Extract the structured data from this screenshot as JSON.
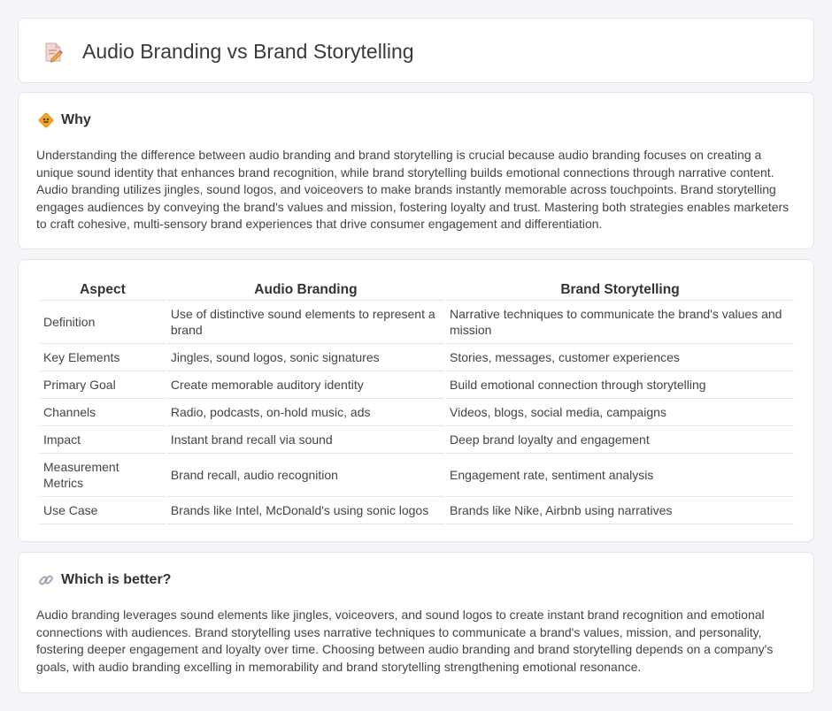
{
  "page": {
    "title": "Audio Branding vs Brand Storytelling",
    "title_icon": "document-pencil-icon"
  },
  "why": {
    "heading": "Why",
    "icon": "diamond-sign-icon",
    "text": "Understanding the difference between audio branding and brand storytelling is crucial because audio branding focuses on creating a unique sound identity that enhances brand recognition, while brand storytelling builds emotional connections through narrative content. Audio branding utilizes jingles, sound logos, and voiceovers to make brands instantly memorable across touchpoints. Brand storytelling engages audiences by conveying the brand's values and mission, fostering loyalty and trust. Mastering both strategies enables marketers to craft cohesive, multi-sensory brand experiences that drive consumer engagement and differentiation."
  },
  "table": {
    "headers": [
      "Aspect",
      "Audio Branding",
      "Brand Storytelling"
    ],
    "rows": [
      [
        "Definition",
        "Use of distinctive sound elements to represent a brand",
        "Narrative techniques to communicate the brand's values and mission"
      ],
      [
        "Key Elements",
        "Jingles, sound logos, sonic signatures",
        "Stories, messages, customer experiences"
      ],
      [
        "Primary Goal",
        "Create memorable auditory identity",
        "Build emotional connection through storytelling"
      ],
      [
        "Channels",
        "Radio, podcasts, on-hold music, ads",
        "Videos, blogs, social media, campaigns"
      ],
      [
        "Impact",
        "Instant brand recall via sound",
        "Deep brand loyalty and engagement"
      ],
      [
        "Measurement Metrics",
        "Brand recall, audio recognition",
        "Engagement rate, sentiment analysis"
      ],
      [
        "Use Case",
        "Brands like Intel, McDonald's using sonic logos",
        "Brands like Nike, Airbnb using narratives"
      ]
    ]
  },
  "better": {
    "heading": "Which is better?",
    "icon": "link-icon",
    "text": "Audio branding leverages sound elements like jingles, voiceovers, and sound logos to create instant brand recognition and emotional connections with audiences. Brand storytelling uses narrative techniques to communicate a brand's values, mission, and personality, fostering deeper engagement and loyalty over time. Choosing between audio branding and brand storytelling depends on a company's goals, with audio branding excelling in memorability and brand storytelling strengthening emotional resonance."
  }
}
